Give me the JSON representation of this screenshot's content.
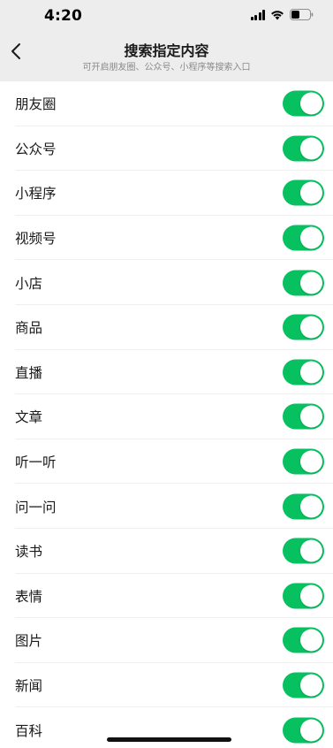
{
  "status_bar": {
    "time": "4:20"
  },
  "header": {
    "title": "搜索指定内容",
    "subtitle": "可开启朋友圈、公众号、小程序等搜索入口"
  },
  "accent_color": "#07c160",
  "items": [
    {
      "label": "朋友圈",
      "enabled": true
    },
    {
      "label": "公众号",
      "enabled": true
    },
    {
      "label": "小程序",
      "enabled": true
    },
    {
      "label": "视频号",
      "enabled": true
    },
    {
      "label": "小店",
      "enabled": true
    },
    {
      "label": "商品",
      "enabled": true
    },
    {
      "label": "直播",
      "enabled": true
    },
    {
      "label": "文章",
      "enabled": true
    },
    {
      "label": "听一听",
      "enabled": true
    },
    {
      "label": "问一问",
      "enabled": true
    },
    {
      "label": "读书",
      "enabled": true
    },
    {
      "label": "表情",
      "enabled": true
    },
    {
      "label": "图片",
      "enabled": true
    },
    {
      "label": "新闻",
      "enabled": true
    },
    {
      "label": "百科",
      "enabled": true
    }
  ]
}
